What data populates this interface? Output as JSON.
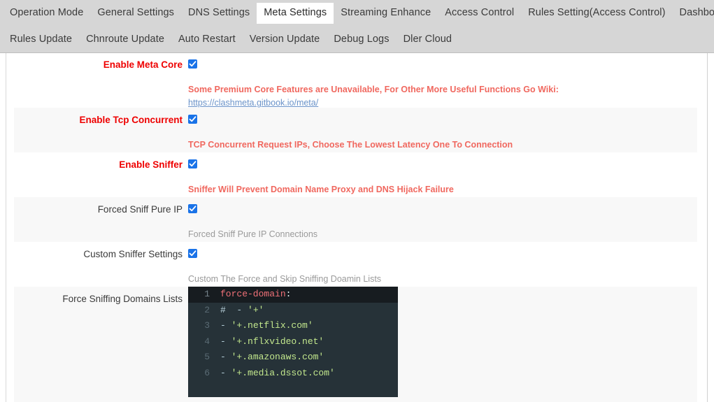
{
  "tabs": {
    "row1": [
      {
        "label": "Operation Mode",
        "active": false
      },
      {
        "label": "General Settings",
        "active": false
      },
      {
        "label": "DNS Settings",
        "active": false
      },
      {
        "label": "Meta Settings",
        "active": true
      },
      {
        "label": "Streaming Enhance",
        "active": false
      },
      {
        "label": "Access Control",
        "active": false
      },
      {
        "label": "Rules Setting(Access Control)",
        "active": false
      },
      {
        "label": "Dashboard Settings",
        "active": false
      }
    ],
    "row2": [
      {
        "label": "Rules Update",
        "active": false
      },
      {
        "label": "Chnroute Update",
        "active": false
      },
      {
        "label": "Auto Restart",
        "active": false
      },
      {
        "label": "Version Update",
        "active": false
      },
      {
        "label": "Debug Logs",
        "active": false
      },
      {
        "label": "Dler Cloud",
        "active": false
      }
    ]
  },
  "form": {
    "rows": [
      {
        "label": "Enable Meta Core",
        "checked": true,
        "desc": "Some Premium Core Features are Unavailable, For Other More Useful Functions Go Wiki:",
        "link": "https://clashmeta.gitbook.io/meta/"
      },
      {
        "label": "Enable Tcp Concurrent",
        "checked": true,
        "desc": "TCP Concurrent Request IPs, Choose The Lowest Latency One To Connection"
      },
      {
        "label": "Enable Sniffer",
        "checked": true,
        "desc": "Sniffer Will Prevent Domain Name Proxy and DNS Hijack Failure"
      },
      {
        "label": "Forced Sniff Pure IP",
        "checked": true,
        "desc": "Forced Sniff Pure IP Connections"
      },
      {
        "label": "Custom Sniffer Settings",
        "checked": true,
        "desc": "Custom The Force and Skip Sniffing Doamin Lists"
      },
      {
        "label": "Force Sniffing Domains Lists"
      }
    ]
  },
  "editor": {
    "lines": [
      {
        "num": "1",
        "active": true,
        "tokens": [
          {
            "t": "force-domain",
            "c": "key"
          },
          {
            "t": ":",
            "c": "punc"
          }
        ]
      },
      {
        "num": "2",
        "active": false,
        "tokens": [
          {
            "t": "#",
            "c": "com"
          },
          {
            "t": "  - ",
            "c": "dash"
          },
          {
            "t": "'+'",
            "c": "str"
          }
        ]
      },
      {
        "num": "3",
        "active": false,
        "tokens": [
          {
            "t": "- ",
            "c": "dash"
          },
          {
            "t": "'+.netflix.com'",
            "c": "str"
          }
        ]
      },
      {
        "num": "4",
        "active": false,
        "tokens": [
          {
            "t": "- ",
            "c": "dash"
          },
          {
            "t": "'+.nflxvideo.net'",
            "c": "str"
          }
        ]
      },
      {
        "num": "5",
        "active": false,
        "tokens": [
          {
            "t": "- ",
            "c": "dash"
          },
          {
            "t": "'+.amazonaws.com'",
            "c": "str"
          }
        ]
      },
      {
        "num": "6",
        "active": false,
        "tokens": [
          {
            "t": "- ",
            "c": "dash"
          },
          {
            "t": "'+.media.dssot.com'",
            "c": "str"
          }
        ]
      }
    ]
  },
  "colors": {
    "label_red": "#ee0000",
    "desc_red": "#f0685f",
    "link_blue": "#6b93c9",
    "checkbox_blue": "#1a73e8",
    "tab_bar_bg": "#d6d6d6",
    "stripe_bg": "#f8f8f8",
    "editor_bg": "#263238",
    "editor_active_line_bg": "#171c20"
  }
}
